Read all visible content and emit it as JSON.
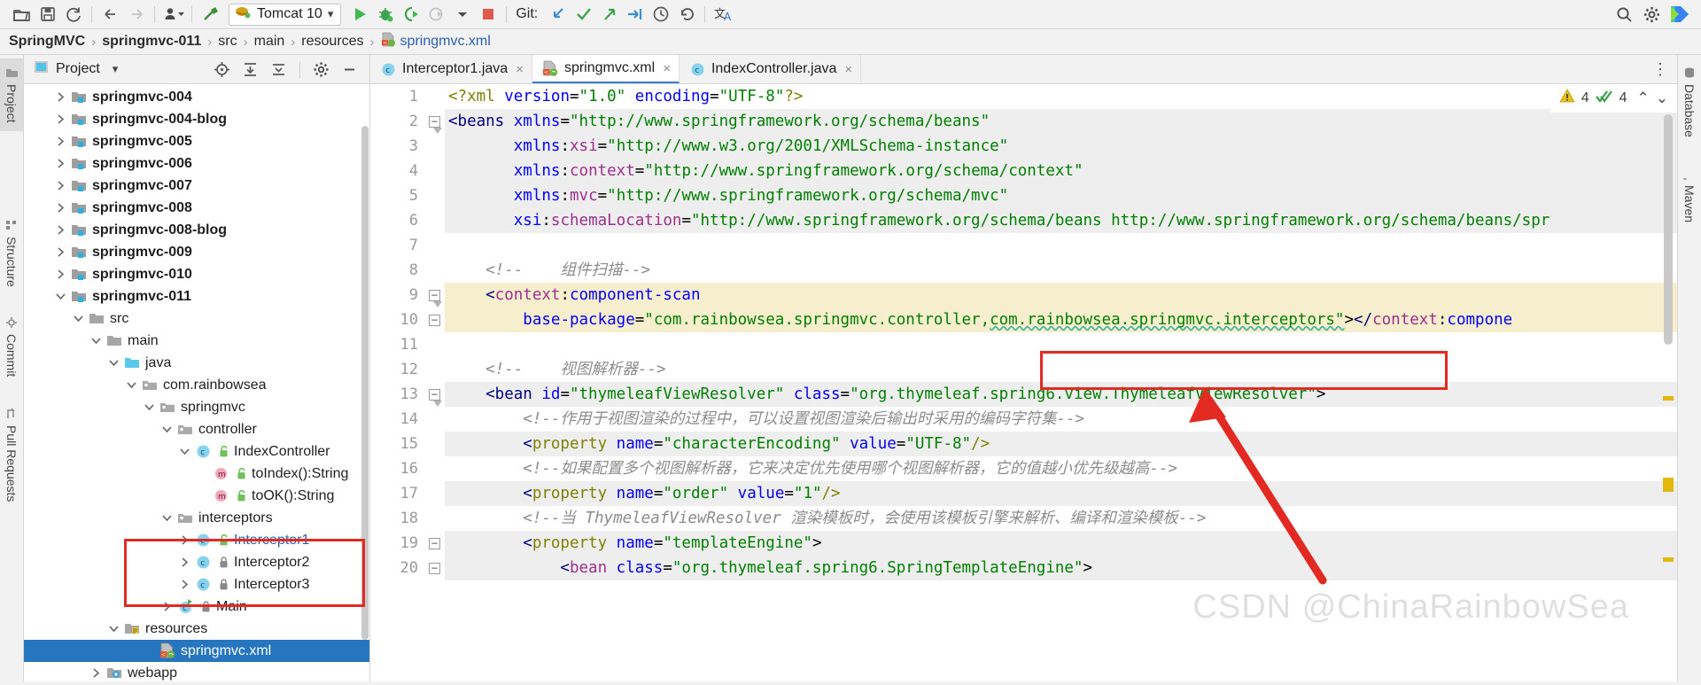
{
  "toolbar": {
    "icons": [
      "open-folder-icon",
      "save-icon",
      "sync-icon",
      "back-arrow-icon",
      "forward-arrow-icon",
      "user-dropdown-icon",
      "build-hammer-icon"
    ],
    "run_config": {
      "label": "Tomcat 10",
      "icon": "tomcat-icon",
      "dropdown": "▾"
    },
    "run_icons": [
      "run-icon",
      "debug-icon",
      "run-with-coverage-icon",
      "profile-icon",
      "profile-dropdown-icon",
      "stop-icon"
    ],
    "git_label": "Git:",
    "git_icons": [
      "update-project-icon",
      "commit-icon",
      "push-icon",
      "rollback-push-icon",
      "history-icon",
      "revert-icon"
    ],
    "translate_icon": "translate-icon",
    "right_icons": [
      "search-icon",
      "settings-gear-icon",
      "ide-logo-icon"
    ]
  },
  "breadcrumb": {
    "items": [
      {
        "label": "SpringMVC",
        "style": "bold"
      },
      {
        "label": "springmvc-011",
        "style": "bold"
      },
      {
        "label": "src",
        "style": "plain"
      },
      {
        "label": "main",
        "style": "plain"
      },
      {
        "label": "resources",
        "style": "plain"
      },
      {
        "label": "springmvc.xml",
        "style": "link"
      }
    ],
    "separator": "›"
  },
  "left_rail": {
    "items": [
      {
        "label": "Project",
        "icon": "project-folder-icon",
        "active": true
      },
      {
        "label": "Structure",
        "icon": "structure-icon",
        "active": false
      },
      {
        "label": "Commit",
        "icon": "commit-icon",
        "active": false
      },
      {
        "label": "Pull Requests",
        "icon": "pull-request-icon",
        "active": false
      }
    ]
  },
  "right_rail": {
    "items": [
      {
        "label": "Database",
        "icon": "database-icon"
      },
      {
        "label": "Maven",
        "icon": "maven-icon"
      }
    ]
  },
  "project_panel": {
    "title": "Project",
    "title_icon": "project-view-icon",
    "dropdown": "▾",
    "tools": [
      "locate-icon",
      "expand-all-icon",
      "collapse-all-icon",
      "settings-gear-icon",
      "hide-icon"
    ],
    "tree": [
      {
        "label": "springmvc-004",
        "indent": 1,
        "arrow": "collapsed",
        "icon": "module-folder-icon",
        "style": "bold"
      },
      {
        "label": "springmvc-004-blog",
        "indent": 1,
        "arrow": "collapsed",
        "icon": "module-folder-icon",
        "style": "bold"
      },
      {
        "label": "springmvc-005",
        "indent": 1,
        "arrow": "collapsed",
        "icon": "module-folder-icon",
        "style": "bold"
      },
      {
        "label": "springmvc-006",
        "indent": 1,
        "arrow": "collapsed",
        "icon": "module-folder-icon",
        "style": "bold"
      },
      {
        "label": "springmvc-007",
        "indent": 1,
        "arrow": "collapsed",
        "icon": "module-folder-icon",
        "style": "bold"
      },
      {
        "label": "springmvc-008",
        "indent": 1,
        "arrow": "collapsed",
        "icon": "module-folder-icon",
        "style": "bold"
      },
      {
        "label": "springmvc-008-blog",
        "indent": 1,
        "arrow": "collapsed",
        "icon": "module-folder-icon",
        "style": "bold"
      },
      {
        "label": "springmvc-009",
        "indent": 1,
        "arrow": "collapsed",
        "icon": "module-folder-icon",
        "style": "bold"
      },
      {
        "label": "springmvc-010",
        "indent": 1,
        "arrow": "collapsed",
        "icon": "module-folder-icon",
        "style": "bold"
      },
      {
        "label": "springmvc-011",
        "indent": 1,
        "arrow": "expanded",
        "icon": "module-folder-icon",
        "style": "bold"
      },
      {
        "label": "src",
        "indent": 2,
        "arrow": "expanded",
        "icon": "folder-icon",
        "style": "plain"
      },
      {
        "label": "main",
        "indent": 3,
        "arrow": "expanded",
        "icon": "folder-icon",
        "style": "plain"
      },
      {
        "label": "java",
        "indent": 4,
        "arrow": "expanded",
        "icon": "source-folder-icon",
        "style": "plain"
      },
      {
        "label": "com.rainbowsea",
        "indent": 5,
        "arrow": "expanded",
        "icon": "package-icon",
        "style": "plain"
      },
      {
        "label": "springmvc",
        "indent": 6,
        "arrow": "expanded",
        "icon": "package-icon",
        "style": "plain"
      },
      {
        "label": "controller",
        "indent": 7,
        "arrow": "expanded",
        "icon": "package-icon",
        "style": "plain"
      },
      {
        "label": "IndexController",
        "indent": 8,
        "arrow": "expanded",
        "icon": "java-class-icon",
        "style": "plain"
      },
      {
        "label": "toIndex():String",
        "indent": 9,
        "arrow": "none",
        "icon": "method-icon",
        "style": "plain"
      },
      {
        "label": "toOK():String",
        "indent": 9,
        "arrow": "none",
        "icon": "method-icon",
        "style": "plain"
      },
      {
        "label": "interceptors",
        "indent": 7,
        "arrow": "expanded",
        "icon": "package-icon",
        "style": "plain"
      },
      {
        "label": "Interceptor1",
        "indent": 8,
        "arrow": "collapsed",
        "icon": "java-class-icon",
        "style": "blue"
      },
      {
        "label": "Interceptor2",
        "indent": 8,
        "arrow": "collapsed",
        "icon": "java-class-icon",
        "style": "plain"
      },
      {
        "label": "Interceptor3",
        "indent": 8,
        "arrow": "collapsed",
        "icon": "java-class-icon",
        "style": "plain"
      },
      {
        "label": "Main",
        "indent": 7,
        "arrow": "collapsed",
        "icon": "java-main-class-icon",
        "style": "plain"
      },
      {
        "label": "resources",
        "indent": 4,
        "arrow": "expanded",
        "icon": "resources-folder-icon",
        "style": "plain"
      },
      {
        "label": "springmvc.xml",
        "indent": 6,
        "arrow": "none",
        "icon": "spring-xml-icon",
        "style": "selected"
      },
      {
        "label": "webapp",
        "indent": 3,
        "arrow": "collapsed",
        "icon": "webapp-folder-icon",
        "style": "plain"
      }
    ]
  },
  "editor": {
    "tabs": [
      {
        "label": "Interceptor1.java",
        "icon": "java-class-icon",
        "active": false,
        "close": "×"
      },
      {
        "label": "springmvc.xml",
        "icon": "spring-xml-icon",
        "active": true,
        "close": "×"
      },
      {
        "label": "IndexController.java",
        "icon": "java-class-icon",
        "active": false,
        "close": "×"
      }
    ],
    "kebab_menu": "⋮",
    "inspection": {
      "warning_icon": "warning-triangle-icon",
      "warning_count": "4",
      "check_icon": "typo-check-icon",
      "check_count": "4",
      "up_arrow": "⌃",
      "down_arrow": "⌄"
    },
    "line_numbers": [
      "1",
      "2",
      "3",
      "4",
      "5",
      "6",
      "7",
      "8",
      "9",
      "10",
      "11",
      "12",
      "13",
      "14",
      "15",
      "16",
      "17",
      "18",
      "19",
      "20"
    ],
    "lines": [
      {
        "num": "1",
        "hl": "white",
        "tokens": [
          {
            "t": "<?",
            "c": "k-proc"
          },
          {
            "t": "xml",
            "c": "k-proc"
          },
          {
            "t": " ",
            "c": "k-punc"
          },
          {
            "t": "version",
            "c": "k-attr"
          },
          {
            "t": "=",
            "c": "k-punc"
          },
          {
            "t": "\"1.0\"",
            "c": "k-val"
          },
          {
            "t": " ",
            "c": "k-punc"
          },
          {
            "t": "encoding",
            "c": "k-attr"
          },
          {
            "t": "=",
            "c": "k-punc"
          },
          {
            "t": "\"UTF-8\"",
            "c": "k-val"
          },
          {
            "t": "?>",
            "c": "k-proc"
          }
        ]
      },
      {
        "num": "2",
        "hl": "grey",
        "fold": "minus-top",
        "tokens": [
          {
            "t": "<beans ",
            "c": "k-tag"
          },
          {
            "t": "xmlns",
            "c": "k-attr"
          },
          {
            "t": "=",
            "c": "k-punc"
          },
          {
            "t": "\"http://www.springframework.org/schema/beans\"",
            "c": "k-val"
          }
        ]
      },
      {
        "num": "3",
        "hl": "grey",
        "tokens": [
          {
            "t": "       ",
            "c": "k-punc"
          },
          {
            "t": "xmlns",
            "c": "k-attr"
          },
          {
            "t": ":",
            "c": "k-punc"
          },
          {
            "t": "xsi",
            "c": "k-ns"
          },
          {
            "t": "=",
            "c": "k-punc"
          },
          {
            "t": "\"http://www.w3.org/2001/XMLSchema-instance\"",
            "c": "k-val"
          }
        ]
      },
      {
        "num": "4",
        "hl": "grey",
        "tokens": [
          {
            "t": "       ",
            "c": "k-punc"
          },
          {
            "t": "xmlns",
            "c": "k-attr"
          },
          {
            "t": ":",
            "c": "k-punc"
          },
          {
            "t": "context",
            "c": "k-ns"
          },
          {
            "t": "=",
            "c": "k-punc"
          },
          {
            "t": "\"http://www.springframework.org/schema/context\"",
            "c": "k-val"
          }
        ]
      },
      {
        "num": "5",
        "hl": "grey",
        "tokens": [
          {
            "t": "       ",
            "c": "k-punc"
          },
          {
            "t": "xmlns",
            "c": "k-attr"
          },
          {
            "t": ":",
            "c": "k-punc"
          },
          {
            "t": "mvc",
            "c": "k-ns"
          },
          {
            "t": "=",
            "c": "k-punc"
          },
          {
            "t": "\"http://www.springframework.org/schema/mvc\"",
            "c": "k-val"
          }
        ]
      },
      {
        "num": "6",
        "hl": "grey",
        "tokens": [
          {
            "t": "       ",
            "c": "k-punc"
          },
          {
            "t": "xsi",
            "c": "k-attr"
          },
          {
            "t": ":",
            "c": "k-punc"
          },
          {
            "t": "schemaLocation",
            "c": "k-ns"
          },
          {
            "t": "=",
            "c": "k-punc"
          },
          {
            "t": "\"http://www.springframework.org/schema/beans http://www.springframework.org/schema/beans/spr",
            "c": "k-val"
          }
        ]
      },
      {
        "num": "7",
        "hl": "white",
        "tokens": []
      },
      {
        "num": "8",
        "hl": "white",
        "tokens": [
          {
            "t": "    <!--    组件扫描-->",
            "c": "k-cmt"
          }
        ]
      },
      {
        "num": "9",
        "hl": "yellow",
        "fold": "minus-top",
        "gutter_icon": "spring-bean-icon",
        "tokens": [
          {
            "t": "    <",
            "c": "k-tag"
          },
          {
            "t": "context",
            "c": "k-ns"
          },
          {
            "t": ":",
            "c": "k-punc"
          },
          {
            "t": "component-scan",
            "c": "k-id"
          }
        ]
      },
      {
        "num": "10",
        "hl": "yellow",
        "fold": "minus",
        "tokens": [
          {
            "t": "        ",
            "c": "k-punc"
          },
          {
            "t": "base-package",
            "c": "k-attr"
          },
          {
            "t": "=",
            "c": "k-punc"
          },
          {
            "t": "\"com.rainbowsea.springmvc.controller,",
            "c": "k-val"
          },
          {
            "t": "com.rainbowsea.springmvc.interceptors\"",
            "c": "k-val squig"
          },
          {
            "t": ">",
            "c": "k-punc"
          },
          {
            "t": "</",
            "c": "k-tag"
          },
          {
            "t": "context",
            "c": "k-ns"
          },
          {
            "t": ":",
            "c": "k-punc"
          },
          {
            "t": "compone",
            "c": "k-id"
          }
        ]
      },
      {
        "num": "11",
        "hl": "white",
        "tokens": []
      },
      {
        "num": "12",
        "hl": "white",
        "tokens": [
          {
            "t": "    <!--    视图解析器-->",
            "c": "k-cmt"
          }
        ]
      },
      {
        "num": "13",
        "hl": "grey",
        "fold": "minus-top",
        "tokens": [
          {
            "t": "    <bean ",
            "c": "k-tag"
          },
          {
            "t": "id",
            "c": "k-attr"
          },
          {
            "t": "=",
            "c": "k-punc"
          },
          {
            "t": "\"thymeleafViewResolver\"",
            "c": "k-val"
          },
          {
            "t": " ",
            "c": "k-punc"
          },
          {
            "t": "class",
            "c": "k-attr"
          },
          {
            "t": "=",
            "c": "k-punc"
          },
          {
            "t": "\"org.thymeleaf.spring6.view.ThymeleafViewResolver\"",
            "c": "k-val"
          },
          {
            "t": ">",
            "c": "k-punc"
          }
        ]
      },
      {
        "num": "14",
        "hl": "white",
        "tokens": [
          {
            "t": "        <!--作用于视图渲染的过程中，可以设置视图渲染后输出时采用的编码字符集-->",
            "c": "k-cmt"
          }
        ]
      },
      {
        "num": "15",
        "hl": "grey",
        "tokens": [
          {
            "t": "        <",
            "c": "k-tag"
          },
          {
            "t": "property ",
            "c": "k-proc"
          },
          {
            "t": "name",
            "c": "k-attr"
          },
          {
            "t": "=",
            "c": "k-punc"
          },
          {
            "t": "\"characterEncoding\"",
            "c": "k-val"
          },
          {
            "t": " ",
            "c": "k-punc"
          },
          {
            "t": "value",
            "c": "k-attr"
          },
          {
            "t": "=",
            "c": "k-punc"
          },
          {
            "t": "\"UTF-8\"",
            "c": "k-val"
          },
          {
            "t": "/>",
            "c": "k-proc"
          }
        ]
      },
      {
        "num": "16",
        "hl": "white",
        "tokens": [
          {
            "t": "        <!--如果配置多个视图解析器，它来决定优先使用哪个视图解析器，它的值越小优先级越高-->",
            "c": "k-cmt"
          }
        ]
      },
      {
        "num": "17",
        "hl": "grey",
        "tokens": [
          {
            "t": "        <",
            "c": "k-tag"
          },
          {
            "t": "property ",
            "c": "k-proc"
          },
          {
            "t": "name",
            "c": "k-attr"
          },
          {
            "t": "=",
            "c": "k-punc"
          },
          {
            "t": "\"order\"",
            "c": "k-val"
          },
          {
            "t": " ",
            "c": "k-punc"
          },
          {
            "t": "value",
            "c": "k-attr"
          },
          {
            "t": "=",
            "c": "k-punc"
          },
          {
            "t": "\"1\"",
            "c": "k-val"
          },
          {
            "t": "/>",
            "c": "k-proc"
          }
        ]
      },
      {
        "num": "18",
        "hl": "white",
        "tokens": [
          {
            "t": "        <!--当 ThymeleafViewResolver 渲染模板时，会使用该模板引擎来解析、编译和渲染模板-->",
            "c": "k-cmt"
          }
        ]
      },
      {
        "num": "19",
        "hl": "grey",
        "fold": "minus",
        "tokens": [
          {
            "t": "        <",
            "c": "k-tag"
          },
          {
            "t": "property ",
            "c": "k-proc"
          },
          {
            "t": "name",
            "c": "k-attr"
          },
          {
            "t": "=",
            "c": "k-punc"
          },
          {
            "t": "\"templateEngine\"",
            "c": "k-val"
          },
          {
            "t": ">",
            "c": "k-punc"
          }
        ]
      },
      {
        "num": "20",
        "hl": "grey",
        "fold": "minus",
        "tokens": [
          {
            "t": "            <",
            "c": "k-tag"
          },
          {
            "t": "bean ",
            "c": "k-ns"
          },
          {
            "t": "class",
            "c": "k-attr"
          },
          {
            "t": "=",
            "c": "k-punc"
          },
          {
            "t": "\"org.thymeleaf.spring6.SpringTemplateEngine\"",
            "c": "k-val"
          },
          {
            "t": ">",
            "c": "k-punc"
          }
        ]
      }
    ]
  },
  "annotations": {
    "watermark": "CSDN @ChinaRainbowSea",
    "highlight_color": "#e32a22",
    "arrow_color": "#e32a22"
  },
  "colors": {
    "accent_blue": "#2675bf",
    "link_blue": "#2b5fb3",
    "yellow_highlight": "#f7eecd",
    "grey_highlight": "#eeeeee",
    "red_annotation": "#e32a22"
  }
}
